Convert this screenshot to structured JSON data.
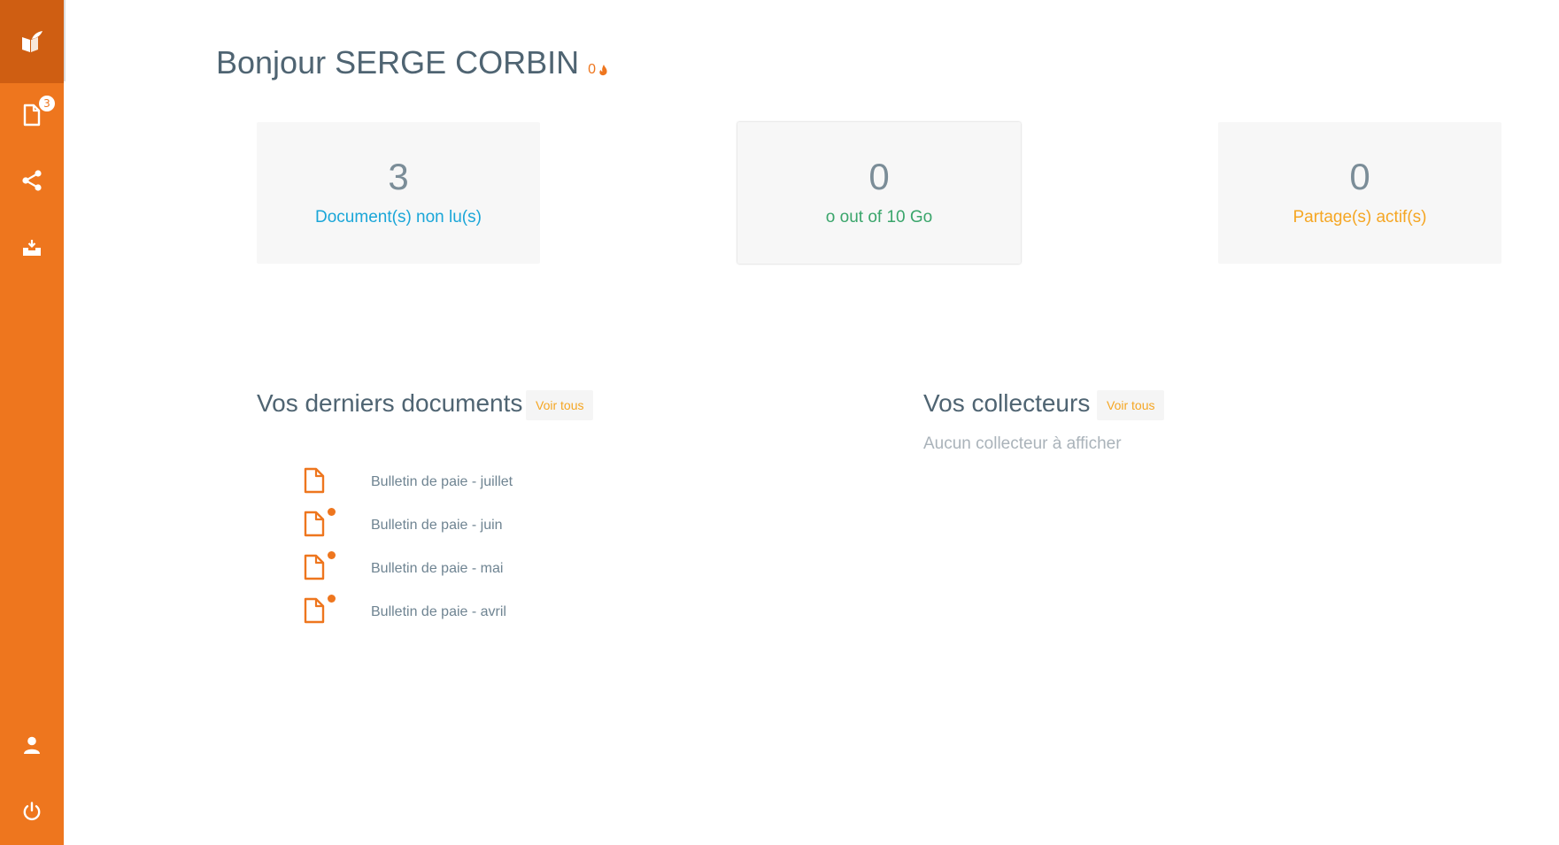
{
  "sidebar": {
    "documents_badge": "3",
    "icons": [
      "logo-icon",
      "document-icon",
      "share-icon",
      "inbox-icon",
      "user-icon",
      "power-icon"
    ]
  },
  "header": {
    "greeting": "Bonjour SERGE CORBIN",
    "streak_count": "0"
  },
  "stats": [
    {
      "value": "3",
      "label": "Document(s) non lu(s)",
      "color": "#1aa6d8"
    },
    {
      "value": "0",
      "label": "o out of 10 Go",
      "color": "#3aa56b"
    },
    {
      "value": "0",
      "label": "Partage(s) actif(s)",
      "color": "#f5a623"
    }
  ],
  "documents_section": {
    "title": "Vos derniers documents",
    "see_all": "Voir tous",
    "items": [
      {
        "name": "Bulletin de paie - juillet",
        "unread": false
      },
      {
        "name": "Bulletin de paie - juin",
        "unread": true
      },
      {
        "name": "Bulletin de paie - mai",
        "unread": true
      },
      {
        "name": "Bulletin de paie - avril",
        "unread": true
      }
    ]
  },
  "collectors_section": {
    "title": "Vos collecteurs",
    "see_all": "Voir tous",
    "empty_message": "Aucun collecteur à afficher"
  },
  "colors": {
    "brand": "#ee761e",
    "brand_dark": "#cf5e12",
    "heading": "#4f6472"
  }
}
